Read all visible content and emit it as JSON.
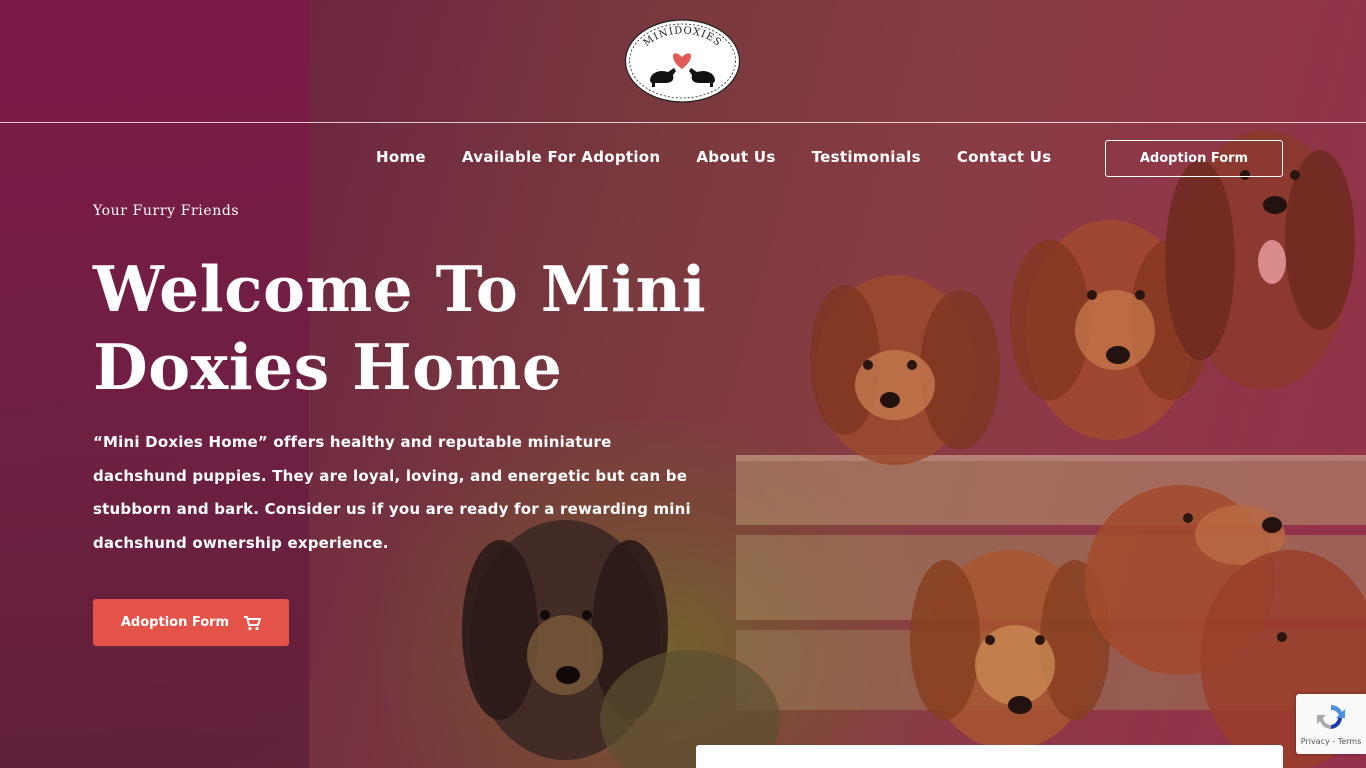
{
  "logo": {
    "text": "MINIDOXIES"
  },
  "nav": {
    "links": [
      "Home",
      "Available For Adoption",
      "About Us",
      "Testimonials",
      "Contact Us"
    ],
    "cta_label": "Adoption Form"
  },
  "hero": {
    "eyebrow": "Your Furry Friends",
    "headline": "Welcome To Mini Doxies Home",
    "intro": "“Mini Doxies Home” offers healthy and reputable miniature dachshund puppies. They are loyal, loving, and energetic but can be stubborn and bark. Consider us if you are ready for a rewarding mini dachshund ownership experience.",
    "cta_label": "Adoption Form",
    "cta_icon": "cart-icon"
  },
  "recaptcha": {
    "terms": "Privacy - Terms"
  },
  "colors": {
    "accent": "#e4534a",
    "background_left": "#7e1a48",
    "background_right": "#95304c"
  }
}
